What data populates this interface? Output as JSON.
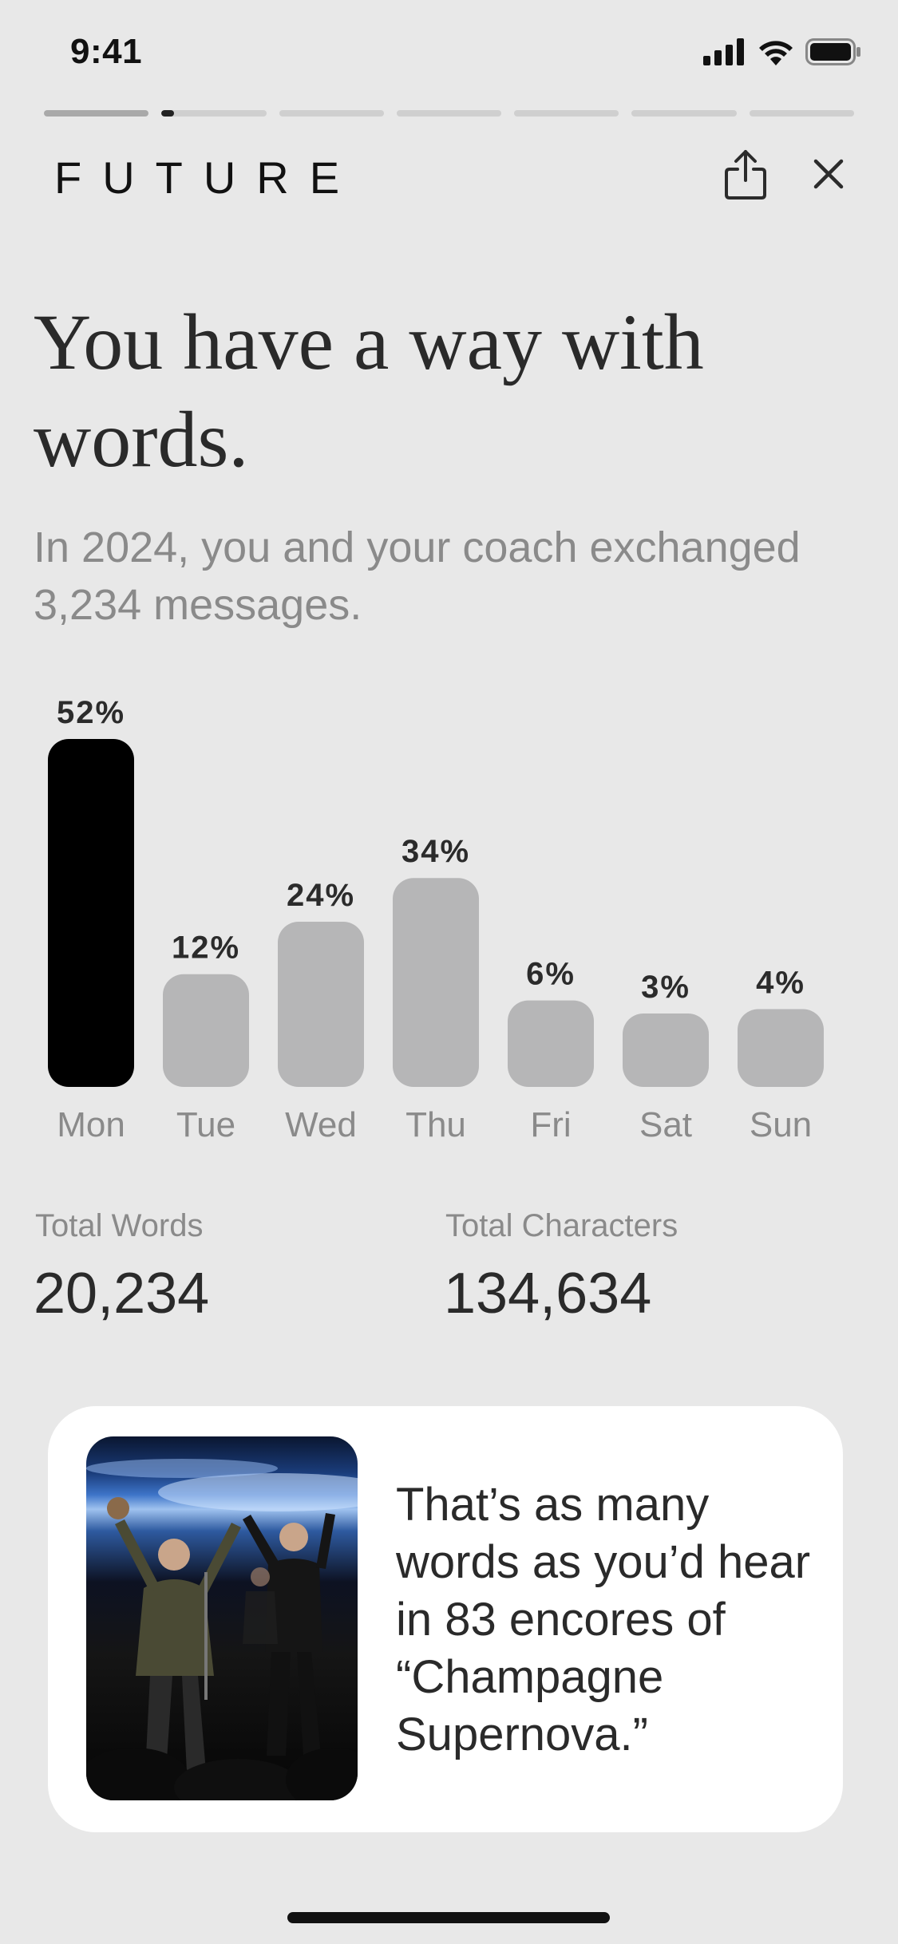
{
  "status_bar": {
    "time": "9:41",
    "icons": [
      "cellular-signal-icon",
      "wifi-icon",
      "battery-icon"
    ]
  },
  "story_progress": {
    "segments": [
      1,
      0.1,
      0,
      0,
      0,
      0,
      0
    ],
    "current_index": 1
  },
  "header": {
    "brand": "FUTURE",
    "share_icon": "share-icon",
    "close_icon": "close-icon"
  },
  "headline": "You have a way with words.",
  "subline": "In 2024, you and your coach exchanged 3,234 messages.",
  "chart_data": {
    "type": "bar",
    "title": "",
    "xlabel": "",
    "ylabel": "",
    "categories": [
      "Mon",
      "Tue",
      "Wed",
      "Thu",
      "Fri",
      "Sat",
      "Sun"
    ],
    "values": [
      52,
      12,
      24,
      34,
      6,
      3,
      4
    ],
    "value_labels": [
      "52%",
      "12%",
      "24%",
      "34%",
      "6%",
      "3%",
      "4%"
    ],
    "highlight_index": 0,
    "colors": {
      "highlight": "#000000",
      "bar": "#b6b6b7",
      "label": "#2b2b2b",
      "axis_label": "#8a8a8a"
    }
  },
  "stats": {
    "words_label": "Total Words",
    "words_value": "20,234",
    "chars_label": "Total Characters",
    "chars_value": "134,634"
  },
  "card": {
    "photo_icon": "concert-photo",
    "text": "That’s as many words as you’d hear in 83 encores of “Champagne Supernova.”"
  },
  "colors": {
    "background": "#e8e8e8",
    "card": "#ffffff",
    "text": "#2a2a2a",
    "muted": "#8a8a8a"
  }
}
